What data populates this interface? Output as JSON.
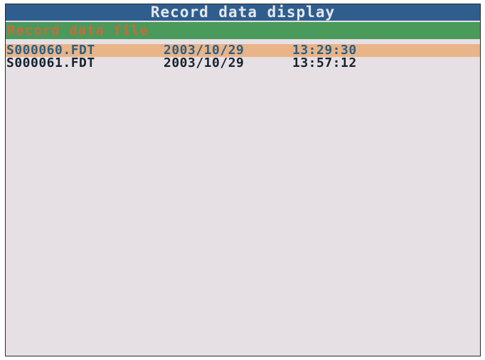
{
  "screen": {
    "title": "Record data display",
    "section_label": "Record data file"
  },
  "files": [
    {
      "name": "S000060.FDT",
      "date": "2003/10/29",
      "time": "13:29:30",
      "selected": true
    },
    {
      "name": "S000061.FDT",
      "date": "2003/10/29",
      "time": "13:57:12",
      "selected": false
    }
  ],
  "colors": {
    "title_bg": "#2f5e8e",
    "section_bg": "#4a9a5c",
    "selection_bg": "#e8b488",
    "screen_bg": "#e6e0e4"
  }
}
